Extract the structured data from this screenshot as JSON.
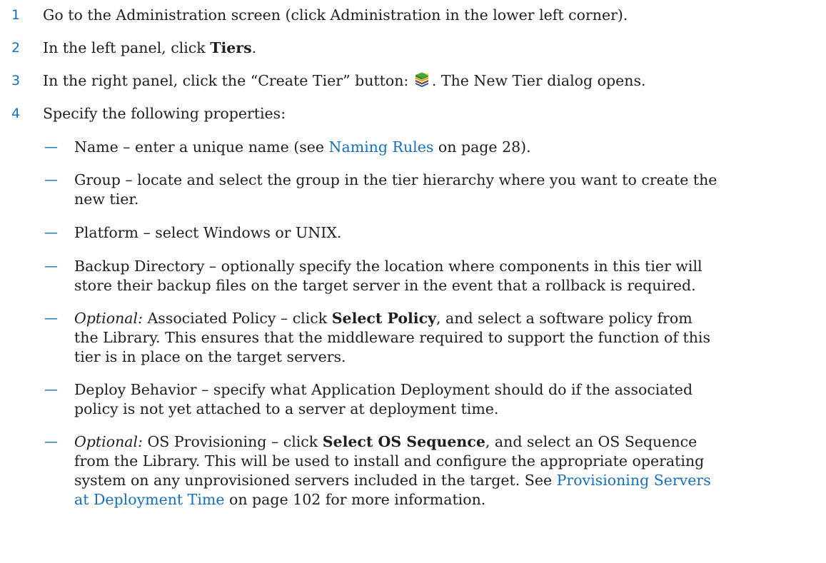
{
  "steps": [
    {
      "number": "1",
      "text": "Go to the Administration screen (click Administration in the lower left corner)."
    },
    {
      "number": "2",
      "prefix": "In the left panel, click ",
      "bold": "Tiers",
      "suffix": "."
    },
    {
      "number": "3",
      "prefix": "In the right panel, click the “Create Tier” button: ",
      "icon": "create-tier-icon",
      "suffix": ". The New Tier dialog opens."
    },
    {
      "number": "4",
      "text": "Specify the following properties:"
    }
  ],
  "properties": {
    "dash": "—",
    "name": {
      "prefix": "Name – enter a unique name (see ",
      "link": "Naming Rules",
      "suffix": " on page 28)."
    },
    "group": {
      "line1": "Group – locate and select the group in the tier hierarchy where you want to create the",
      "line2": "new tier."
    },
    "platform": {
      "text": "Platform – select Windows or UNIX."
    },
    "backup": {
      "line1": "Backup Directory – optionally specify the location where components in this tier will",
      "line2": "store their backup files on the target server in the event that a rollback is required."
    },
    "policy": {
      "italic": "Optional:",
      "prefix": " Associated Policy – click ",
      "bold": "Select Policy",
      "suffix": ", and select a software policy from",
      "line2": "the Library. This ensures that the middleware required to support the function of this",
      "line3": "tier is in place on the target servers."
    },
    "deploy": {
      "line1": "Deploy Behavior – specify what Application Deployment should do if the associated",
      "line2": "policy is not yet attached to a server at deployment time."
    },
    "os": {
      "italic": "Optional:",
      "prefix": " OS Provisioning – click ",
      "bold": "Select OS Sequence",
      "suffix": ", and select an OS Sequence",
      "line2": "from the Library. This will be used to install and configure the appropriate operating",
      "line3_prefix": "system on any unprovisioned servers included in the target. See ",
      "link_part1": "Provisioning Servers",
      "link_part2": "at Deployment Time",
      "line4_suffix": " on page 102 for more information."
    }
  },
  "colors": {
    "accent": "#1b6fb0",
    "text": "#1f1f1f"
  }
}
